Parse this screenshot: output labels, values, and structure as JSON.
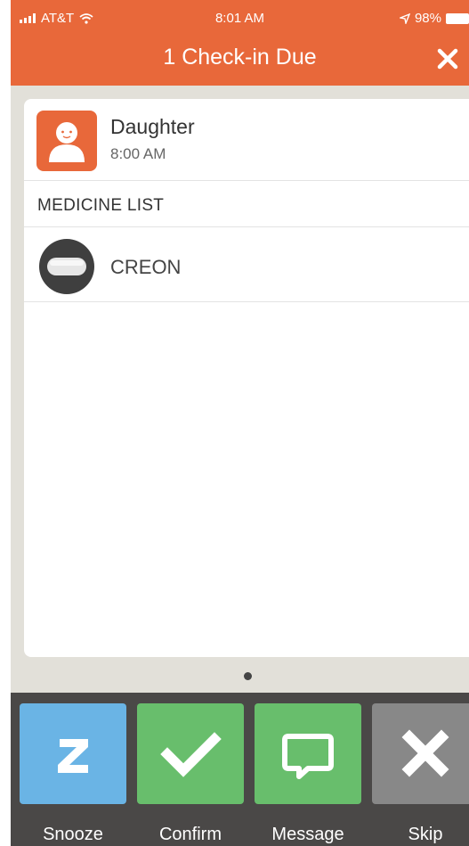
{
  "status_bar": {
    "carrier": "AT&T",
    "time": "8:01 AM",
    "battery": "98%"
  },
  "header": {
    "title": "1 Check-in Due"
  },
  "profile": {
    "name": "Daughter",
    "time": "8:00 AM"
  },
  "medicine_list": {
    "heading": "MEDICINE LIST",
    "items": [
      {
        "name": "CREON"
      }
    ]
  },
  "actions": {
    "snooze": "Snooze",
    "confirm": "Confirm",
    "message": "Message",
    "skip": "Skip"
  },
  "colors": {
    "header": "#e8683a",
    "snooze": "#6ab4e5",
    "confirm": "#68be6c",
    "message": "#68be6c",
    "skip": "#888888"
  }
}
